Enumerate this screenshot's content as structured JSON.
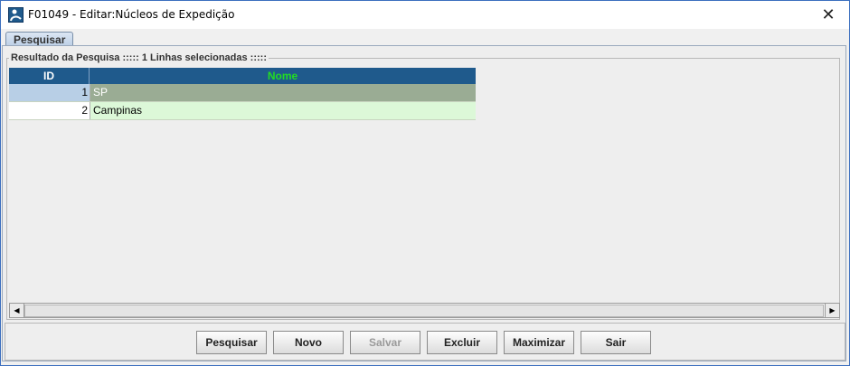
{
  "window": {
    "title": "F01049 - Editar:Núcleos de Expedição",
    "close_glyph": "✕"
  },
  "tabs": [
    {
      "label": "Pesquisar",
      "active": true
    }
  ],
  "results": {
    "legend": "Resultado da Pesquisa ::::: 1 Linhas selecionadas :::::",
    "columns": [
      "ID",
      "Nome"
    ],
    "rows": [
      {
        "id": "1",
        "nome": "SP",
        "selected": true
      },
      {
        "id": "2",
        "nome": "Campinas",
        "selected": false
      }
    ]
  },
  "scrollbar": {
    "left_arrow": "◀",
    "right_arrow": "▶"
  },
  "buttons": {
    "pesquisar": "Pesquisar",
    "novo": "Novo",
    "salvar": "Salvar",
    "excluir": "Excluir",
    "maximizar": "Maximizar",
    "sair": "Sair"
  },
  "colors": {
    "header_bg": "#1f5a8c",
    "nome_header_text": "#22dd22",
    "selected_row": "#9aac94",
    "normal_row": "#dcf8d8"
  },
  "icons": {
    "app": "app-logo-icon",
    "close": "close-icon"
  }
}
